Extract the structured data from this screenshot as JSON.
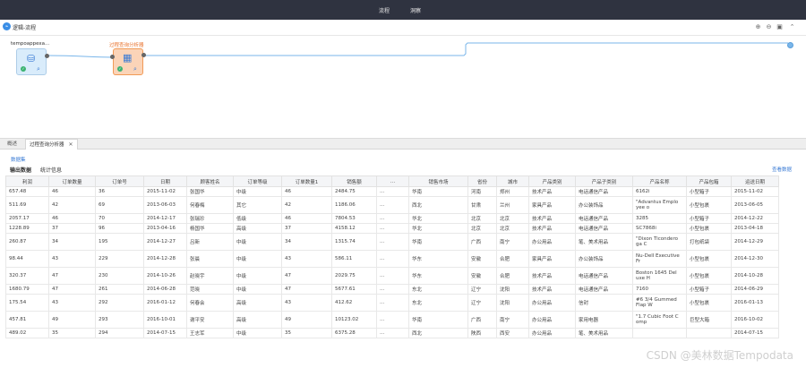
{
  "topbar": {
    "tabs": [
      "流程",
      "洞察"
    ]
  },
  "canvas_header": {
    "title": "逻辑-流程",
    "tools": [
      "zoom-in-icon",
      "zoom-out-icon",
      "fit-icon",
      "collapse-icon"
    ]
  },
  "nodes": [
    {
      "label": "tempoappexa...",
      "type": "dataset"
    },
    {
      "label": "过程查询分析器",
      "type": "analyzer"
    }
  ],
  "panel": {
    "tabs": [
      "概述",
      "过程查询分析器"
    ],
    "dataset_link": "数据集",
    "subtabs": [
      "输出数据",
      "统计信息"
    ],
    "view_data": "查看数据"
  },
  "table": {
    "columns": [
      "利润",
      "订单数量",
      "订单号",
      "日期",
      "顾客姓名",
      "订单等级",
      "订单数量1",
      "销售额",
      "...",
      "销售市场",
      "省份",
      "城市",
      "产品类别",
      "产品子类别",
      "产品名称",
      "产品包箱",
      "运送日期"
    ],
    "rows": [
      [
        "657.48",
        "46",
        "36",
        "2015-11-02",
        "张国华",
        "中级",
        "46",
        "2484.75",
        "...",
        "华南",
        "河南",
        "郑州",
        "技术产品",
        "电话通信产品",
        "6162i",
        "小型箱子",
        "2015-11-02"
      ],
      [
        "511.69",
        "42",
        "69",
        "2013-06-03",
        "何春梅",
        "其它",
        "42",
        "1186.06",
        "...",
        "西北",
        "甘肃",
        "兰州",
        "家具产品",
        "办公装饰品",
        "\"Advantus Emplo yee o",
        "小型包裹",
        "2013-06-05"
      ],
      [
        "2057.17",
        "46",
        "70",
        "2014-12-17",
        "张瑞珍",
        "低级",
        "46",
        "7804.53",
        "...",
        "华北",
        "北京",
        "北京",
        "技术产品",
        "电话通信产品",
        "3285",
        "小型箱子",
        "2014-12-22"
      ],
      [
        "1228.89",
        "37",
        "96",
        "2013-04-16",
        "杨国华",
        "高级",
        "37",
        "4158.12",
        "...",
        "华北",
        "北京",
        "北京",
        "技术产品",
        "电话通信产品",
        "SC7868i",
        "小型包裹",
        "2013-04-18"
      ],
      [
        "260.87",
        "34",
        "195",
        "2014-12-27",
        "吕新",
        "中级",
        "34",
        "1315.74",
        "...",
        "华南",
        "广西",
        "南宁",
        "办公用品",
        "笔、美术用品",
        "\"Dixon Ticondero ga C",
        "打包纸袋",
        "2014-12-29"
      ],
      [
        "98.44",
        "43",
        "229",
        "2014-12-28",
        "张晨",
        "中级",
        "43",
        "586.11",
        "...",
        "华东",
        "安徽",
        "合肥",
        "家具产品",
        "办公装饰品",
        "Nu-Dell Executive Fr",
        "小型包裹",
        "2014-12-30"
      ],
      [
        "320.37",
        "47",
        "230",
        "2014-10-26",
        "赵晓宇",
        "中级",
        "47",
        "2029.75",
        "...",
        "华东",
        "安徽",
        "合肥",
        "技术产品",
        "电话通信产品",
        "Boston 1645 Del uxe H",
        "小型包裹",
        "2014-10-28"
      ],
      [
        "1680.79",
        "47",
        "261",
        "2014-06-28",
        "范晓",
        "中级",
        "47",
        "5677.61",
        "...",
        "东北",
        "辽宁",
        "沈阳",
        "技术产品",
        "电话通信产品",
        "7160",
        "小型箱子",
        "2014-06-29"
      ],
      [
        "175.54",
        "43",
        "292",
        "2016-01-12",
        "何春会",
        "高级",
        "43",
        "412.62",
        "...",
        "东北",
        "辽宁",
        "沈阳",
        "办公用品",
        "信封",
        "#6 3/4 Gummed Flap W",
        "小型包裹",
        "2016-01-13"
      ],
      [
        "457.81",
        "49",
        "293",
        "2016-10-01",
        "谢平安",
        "高级",
        "49",
        "10123.02",
        "...",
        "华南",
        "广西",
        "南宁",
        "办公用品",
        "家用电器",
        "\"1.7 Cubic Foot C omp",
        "巨型大箱",
        "2016-10-02"
      ],
      [
        "489.02",
        "35",
        "294",
        "2014-07-15",
        "王志军",
        "中级",
        "35",
        "6375.28",
        "...",
        "西北",
        "陕西",
        "西安",
        "办公用品",
        "笔、美术用品",
        "",
        "",
        "2014-07-15"
      ]
    ]
  },
  "watermark": "CSDN @美林数据Tempodata",
  "colors": {
    "topbar": "#2f3340",
    "link": "#3a7bd5",
    "node_dataset": "#d9ecfb",
    "node_analyzer": "#fbd4b8",
    "edge": "#7ab6ea"
  }
}
